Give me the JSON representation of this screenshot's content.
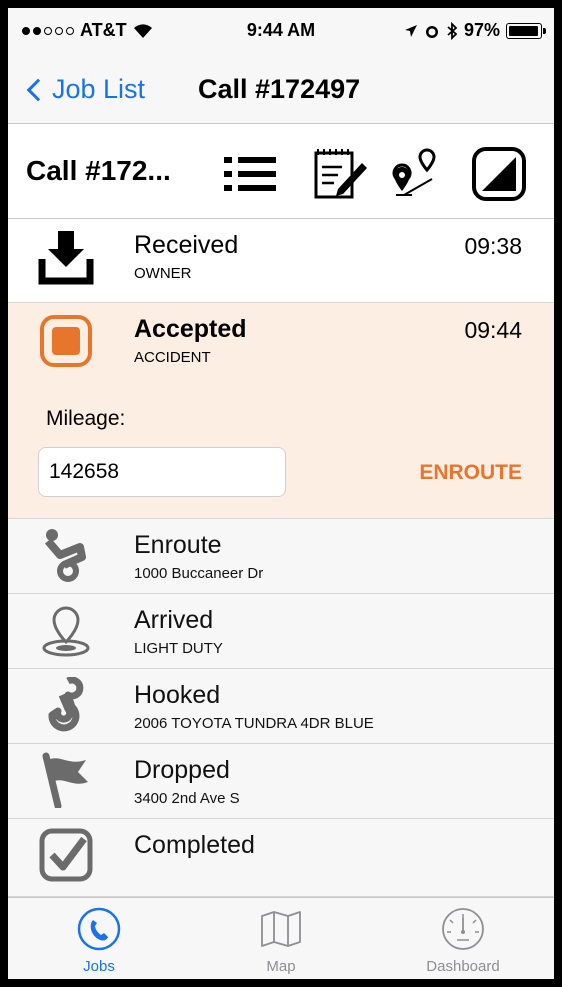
{
  "status_bar": {
    "carrier": "AT&T",
    "time": "9:44 AM",
    "battery": "97%"
  },
  "nav": {
    "back_label": "Job List",
    "title": "Call #172497"
  },
  "toolbar": {
    "title": "Call #172...",
    "icons": [
      "list-icon",
      "notepad-icon",
      "route-icon",
      "status-toggle-icon"
    ]
  },
  "statuses": [
    {
      "title": "Received",
      "subtitle": "OWNER",
      "time": "09:38",
      "icon": "download-icon"
    },
    {
      "title": "Accepted",
      "subtitle": "ACCIDENT",
      "time": "09:44",
      "icon": "orange-square-icon"
    },
    {
      "title": "Enroute",
      "subtitle": "1000 Buccaneer Dr",
      "icon": "tow-truck-icon"
    },
    {
      "title": "Arrived",
      "subtitle": "LIGHT DUTY",
      "icon": "location-pin-icon"
    },
    {
      "title": "Hooked",
      "subtitle": "2006 TOYOTA TUNDRA 4DR BLUE",
      "icon": "hook-icon"
    },
    {
      "title": "Dropped",
      "subtitle": "3400 2nd Ave S",
      "icon": "flag-icon"
    },
    {
      "title": "Completed",
      "subtitle": "",
      "icon": "checkbox-icon"
    }
  ],
  "mileage": {
    "label": "Mileage:",
    "value": "142658",
    "action": "ENROUTE"
  },
  "tabs": [
    {
      "label": "Jobs",
      "icon": "phone-icon",
      "selected": true
    },
    {
      "label": "Map",
      "icon": "map-icon",
      "selected": false
    },
    {
      "label": "Dashboard",
      "icon": "gauge-icon",
      "selected": false
    }
  ],
  "colors": {
    "accent_blue": "#1a73e8",
    "accent_orange": "#e8752c",
    "active_row_bg": "#fdeee3"
  }
}
